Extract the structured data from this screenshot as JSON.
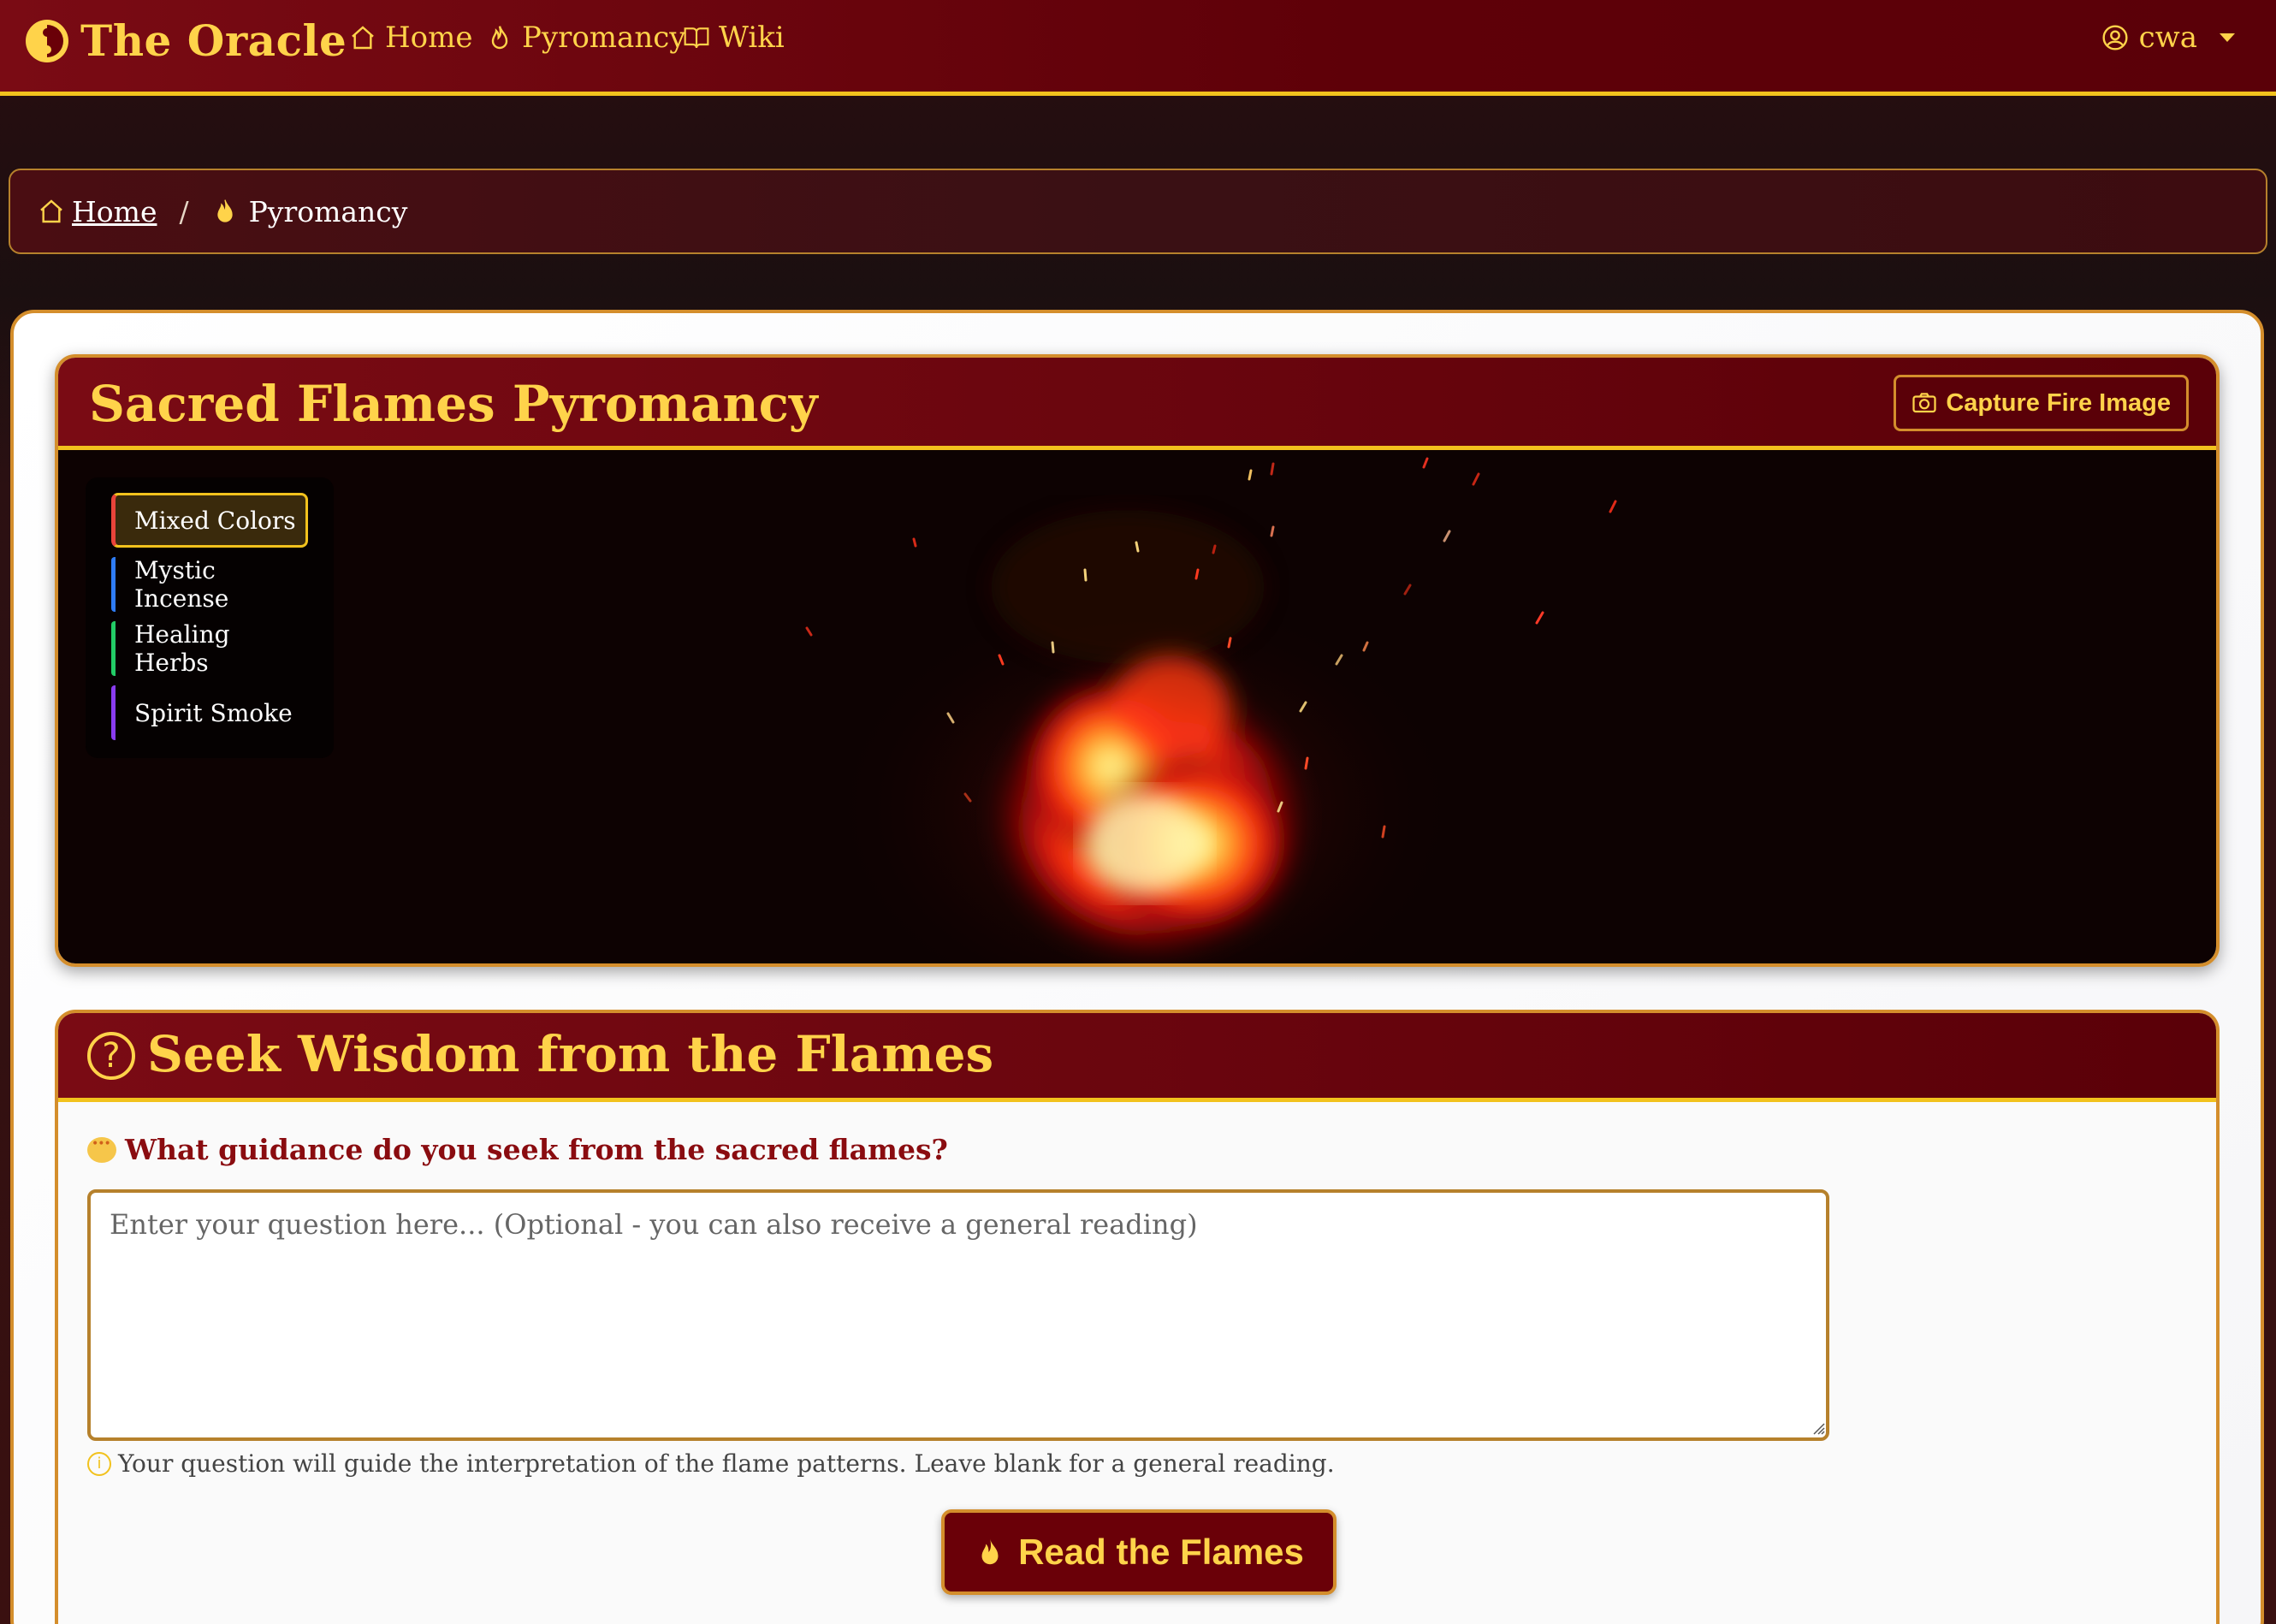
{
  "navbar": {
    "brand": "The Oracle",
    "links": [
      {
        "label": "Home",
        "icon": "home-icon"
      },
      {
        "label": "Pyromancy",
        "icon": "flame-icon"
      },
      {
        "label": "Wiki",
        "icon": "book-icon"
      }
    ],
    "user": "cwa"
  },
  "breadcrumb": {
    "home": "Home",
    "separator": "/",
    "current": "Pyromancy"
  },
  "fire_card": {
    "title": "Sacred Flames Pyromancy",
    "capture_label": "Capture Fire Image",
    "options": [
      {
        "label": "Mixed Colors",
        "color": "#e9443a",
        "active": true
      },
      {
        "label": "Mystic Incense",
        "color": "#2f7cf5",
        "active": false
      },
      {
        "label": "Healing Herbs",
        "color": "#22cc66",
        "active": false
      },
      {
        "label": "Spirit Smoke",
        "color": "#8a3cf0",
        "active": false
      }
    ]
  },
  "wisdom": {
    "title": "Seek Wisdom from the Flames",
    "question_icon": "?",
    "prompt": "What guidance do you seek from the sacred flames?",
    "placeholder": "Enter your question here... (Optional - you can also receive a general reading)",
    "value": "",
    "hint": "Your question will guide the interpretation of the flame patterns. Leave blank for a general reading.",
    "read_label": "Read the Flames"
  },
  "colors": {
    "accent_gold": "#ffd34a",
    "border_gold": "#d48e2c",
    "brand_red": "#6a0008"
  }
}
